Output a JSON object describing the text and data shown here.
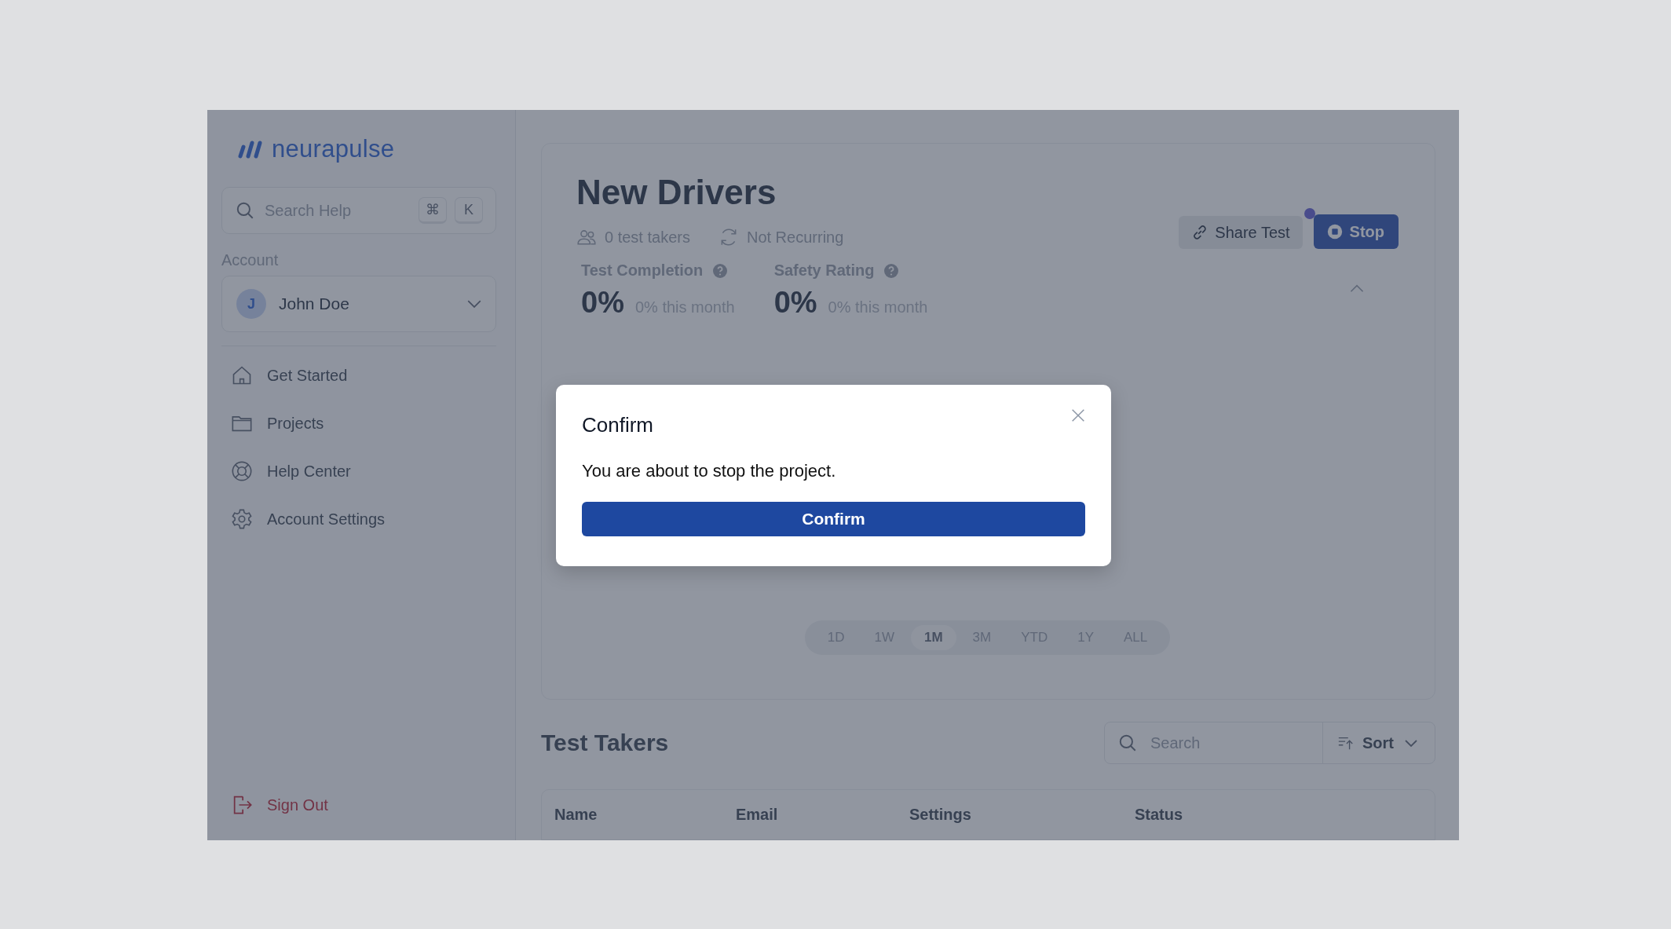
{
  "sidebar": {
    "logo": "neurapulse",
    "search": {
      "placeholder": "Search Help",
      "keys": [
        "⌘",
        "K"
      ]
    },
    "account_label": "Account",
    "account": {
      "initial": "J",
      "name": "John Doe"
    },
    "items": [
      {
        "label": "Get Started",
        "kind": "home"
      },
      {
        "label": "Projects",
        "kind": "folder"
      },
      {
        "label": "Help Center",
        "kind": "help"
      },
      {
        "label": "Account Settings",
        "kind": "settings"
      }
    ],
    "sign_out": "Sign Out"
  },
  "project": {
    "title": "New Drivers",
    "takers": "0 test takers",
    "recurrence": "Not Recurring",
    "share_button": {
      "label": "Share Test",
      "notification": true
    },
    "stop_button": "Stop",
    "stats": [
      {
        "label": "Test Completion",
        "value": "0%",
        "change": "0% this month"
      },
      {
        "label": "Safety Rating",
        "value": "0%",
        "change": "0% this month"
      }
    ],
    "periods": [
      {
        "label": "1D",
        "selected": false
      },
      {
        "label": "1W",
        "selected": false
      },
      {
        "label": "1M",
        "selected": true
      },
      {
        "label": "3M",
        "selected": false
      },
      {
        "label": "YTD",
        "selected": false
      },
      {
        "label": "1Y",
        "selected": false
      },
      {
        "label": "ALL",
        "selected": false
      }
    ]
  },
  "test_takers": {
    "title": "Test Takers",
    "search": {
      "placeholder": "Search"
    },
    "sort": "Sort",
    "columns": [
      "Name",
      "Email",
      "Settings",
      "Status"
    ]
  },
  "dialog": {
    "title": "Confirm",
    "message": "You are about to stop the project.",
    "confirm": "Confirm"
  }
}
